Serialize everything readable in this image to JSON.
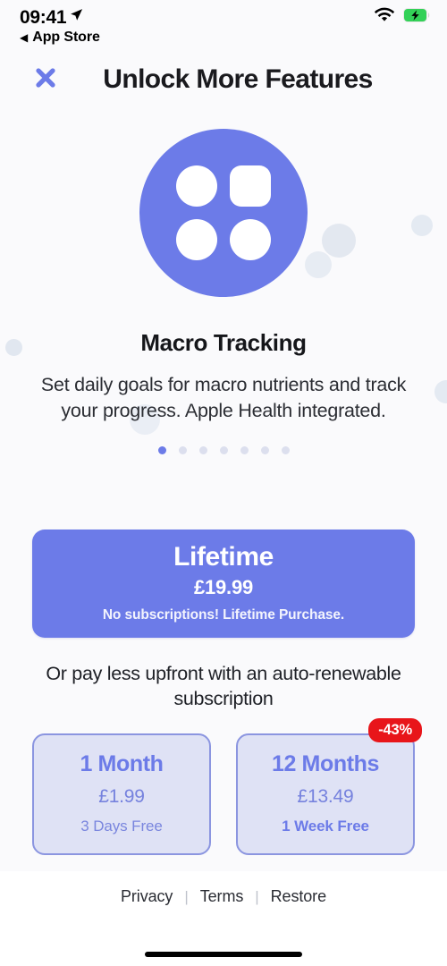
{
  "status_bar": {
    "time": "09:41",
    "location_icon": "location-arrow-icon",
    "back_caret": "◀",
    "back_label": "App Store",
    "wifi_icon": "wifi-icon",
    "battery_icon": "battery-charging-icon"
  },
  "header": {
    "close_icon": "close-x-icon",
    "title": "Unlock More Features"
  },
  "feature": {
    "hero_icon": "macro-grid-icon",
    "title": "Macro Tracking",
    "description": "Set daily goals for macro nutrients and track your progress. Apple Health integrated.",
    "pager": {
      "total": 7,
      "active_index": 0
    }
  },
  "lifetime": {
    "title": "Lifetime",
    "price": "£19.99",
    "note": "No subscriptions! Lifetime Purchase."
  },
  "subscription_blurb": "Or pay less upfront with an auto-renewable subscription",
  "plans": [
    {
      "name": "1 Month",
      "price": "£1.99",
      "trial": "3 Days Free",
      "badge": null
    },
    {
      "name": "12 Months",
      "price": "£13.49",
      "trial": "1 Week Free",
      "badge": "-43%"
    }
  ],
  "footer": {
    "privacy": "Privacy",
    "terms": "Terms",
    "restore": "Restore",
    "separator": "|",
    "home_indicator": "home-indicator"
  },
  "colors": {
    "accent": "#6C7BE8",
    "page_background": "#FAFAFC",
    "card_fill": "#DFE2F5",
    "card_border": "#8B95E0",
    "badge_red": "#E8151A",
    "bubble": "#E3E8F0"
  }
}
